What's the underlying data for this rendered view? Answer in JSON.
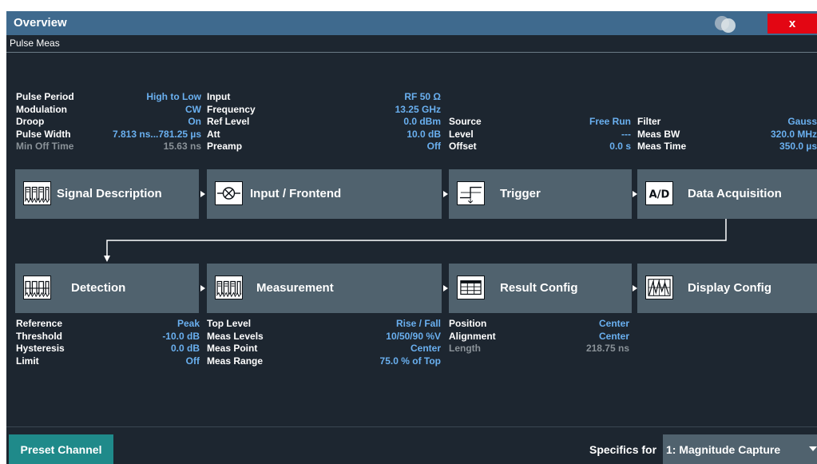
{
  "window": {
    "title": "Overview",
    "close_label": "x",
    "tab": "Pulse Meas"
  },
  "colors": {
    "titlebar": "#3f6a8e",
    "background": "#1d2630",
    "block": "#50626e",
    "value_text": "#6ab0f0",
    "close": "#e30613",
    "preset": "#1f8a8a"
  },
  "signal_info": [
    {
      "label": "Pulse Period",
      "value": "High to Low"
    },
    {
      "label": "Modulation",
      "value": "CW"
    },
    {
      "label": "Droop",
      "value": "On"
    },
    {
      "label": "Pulse Width",
      "value": "7.813 ns...781.25 µs"
    },
    {
      "label": "Min Off Time",
      "value": "15.63 ns"
    }
  ],
  "input_info": [
    {
      "label": "Input",
      "value": "RF 50 Ω"
    },
    {
      "label": "Frequency",
      "value": "13.25 GHz"
    },
    {
      "label": "Ref Level",
      "value": "0.0 dBm"
    },
    {
      "label": "Att",
      "value": "10.0 dB"
    },
    {
      "label": "Preamp",
      "value": "Off"
    }
  ],
  "trigger_info": [
    {
      "label": "Source",
      "value": "Free Run"
    },
    {
      "label": "Level",
      "value": "---"
    },
    {
      "label": "Offset",
      "value": "0.0 s"
    }
  ],
  "acq_info": [
    {
      "label": "Filter",
      "value": "Gauss"
    },
    {
      "label": "Meas BW",
      "value": "320.0 MHz"
    },
    {
      "label": "Meas Time",
      "value": "350.0 µs"
    }
  ],
  "blocks_row1": [
    {
      "label": "Signal Description",
      "icon": "pulse-waveform-icon"
    },
    {
      "label": "Input / Frontend",
      "icon": "mixer-icon"
    },
    {
      "label": "Trigger",
      "icon": "trigger-edge-icon"
    },
    {
      "label": "Data Acquisition",
      "icon": "ad-converter-icon",
      "icon_text": "A/D"
    }
  ],
  "blocks_row2": [
    {
      "label": "Detection",
      "icon": "pulse-detection-icon"
    },
    {
      "label": "Measurement",
      "icon": "pulse-measurement-icon"
    },
    {
      "label": "Result Config",
      "icon": "table-icon"
    },
    {
      "label": "Display Config",
      "icon": "display-chart-icon"
    }
  ],
  "detection_info": [
    {
      "label": "Reference",
      "value": "Peak"
    },
    {
      "label": "Threshold",
      "value": "-10.0 dB"
    },
    {
      "label": "Hysteresis",
      "value": "0.0 dB"
    },
    {
      "label": "Limit",
      "value": "Off"
    }
  ],
  "measurement_info": [
    {
      "label": "Top Level",
      "value": "Rise / Fall"
    },
    {
      "label": "Meas Levels",
      "value": "10/50/90 %V"
    },
    {
      "label": "Meas Point",
      "value": "Center"
    },
    {
      "label": "Meas Range",
      "value": "75.0 % of Top"
    }
  ],
  "result_info": [
    {
      "label": "Position",
      "value": "Center"
    },
    {
      "label": "Alignment",
      "value": "Center"
    },
    {
      "label": "Length",
      "value": "218.75 ns"
    }
  ],
  "bottom": {
    "preset_label": "Preset Channel",
    "specifics_label": "Specifics for",
    "specifics_value": "1: Magnitude Capture"
  }
}
